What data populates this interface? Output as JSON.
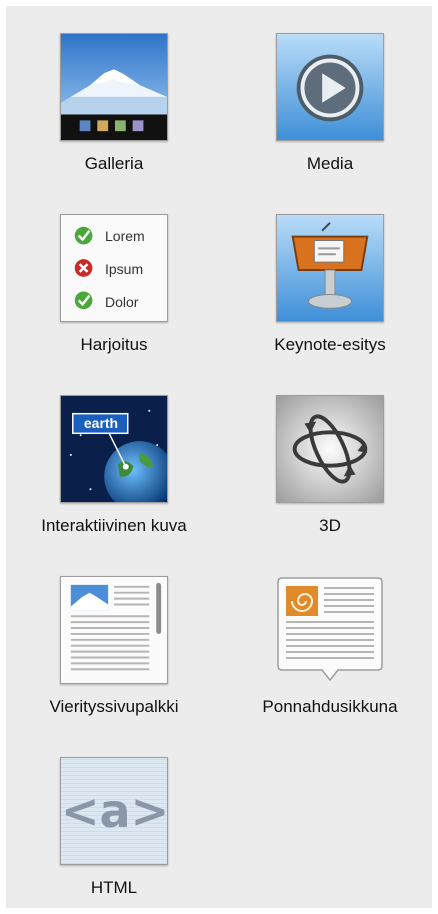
{
  "widgets": [
    {
      "label": "Galleria",
      "icon": "gallery-icon"
    },
    {
      "label": "Media",
      "icon": "media-play-icon"
    },
    {
      "label": "Harjoitus",
      "icon": "quiz-icon",
      "options": [
        "Lorem",
        "Ipsum",
        "Dolor"
      ]
    },
    {
      "label": "Keynote-esitys",
      "icon": "keynote-podium-icon"
    },
    {
      "label": "Interaktiivinen kuva",
      "icon": "interactive-image-icon",
      "callout": "earth"
    },
    {
      "label": "3D",
      "icon": "3d-rotate-icon"
    },
    {
      "label": "Vierityssivupalkki",
      "icon": "scrolling-sidebar-icon"
    },
    {
      "label": "Ponnahdusikkuna",
      "icon": "popover-icon"
    },
    {
      "label": "HTML",
      "icon": "html-icon",
      "glyph": "<a>"
    }
  ]
}
